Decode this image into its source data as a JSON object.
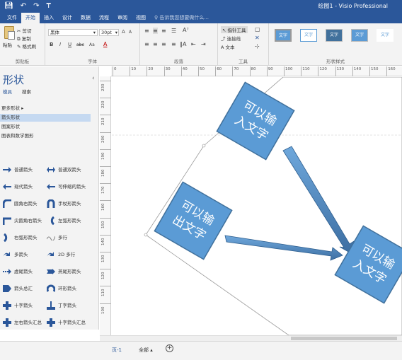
{
  "window": {
    "title": "绘图1 - Visio Professional",
    "qat": {
      "save_icon": "save-icon",
      "undo_icon": "undo-icon",
      "redo_icon": "redo-icon",
      "customize_icon": "customize-icon"
    }
  },
  "tabs": [
    {
      "label": "文件"
    },
    {
      "label": "开始"
    },
    {
      "label": "插入"
    },
    {
      "label": "设计"
    },
    {
      "label": "数据"
    },
    {
      "label": "流程"
    },
    {
      "label": "审阅"
    },
    {
      "label": "视图"
    }
  ],
  "tell_me": "♀ 告诉我您想要做什么...",
  "ribbon": {
    "clipboard": {
      "paste": "粘贴",
      "cut": "剪切",
      "copy": "复制",
      "format_painter": "格式刷",
      "label": "剪贴板"
    },
    "font": {
      "font_name": "黑体",
      "font_size": "30pt",
      "bold": "B",
      "italic": "I",
      "underline": "U",
      "strike": "abc",
      "case": "Aa",
      "font_color": "A",
      "grow": "A",
      "shrink": "A",
      "label": "字体"
    },
    "paragraph": {
      "label": "段落"
    },
    "tools": {
      "pointer": "指针工具",
      "connector": "连接线",
      "text": "A 文本",
      "label": "工具"
    },
    "shape_styles": {
      "label": "形状样式",
      "sample": "文字"
    }
  },
  "panel": {
    "title": "形状",
    "tabs": [
      "模具",
      "搜索"
    ],
    "stencils": [
      {
        "label": "更多形状  ▸"
      },
      {
        "label": "箭头形状"
      },
      {
        "label": "图案形状"
      },
      {
        "label": "图表和数学图形"
      }
    ],
    "shapes": [
      {
        "label": "普通箭头"
      },
      {
        "label": "普通双箭头"
      },
      {
        "label": "现代箭头"
      },
      {
        "label": "可伸缩的箭头"
      },
      {
        "label": "圆角右箭头"
      },
      {
        "label": "手杖形箭头"
      },
      {
        "label": "尖圆角右箭头"
      },
      {
        "label": "左弧形箭头"
      },
      {
        "label": "右弧形箭头"
      },
      {
        "label": "多行"
      },
      {
        "label": "多箭头"
      },
      {
        "label": "2D 多行"
      },
      {
        "label": "虚尾箭头"
      },
      {
        "label": "燕尾形箭头"
      },
      {
        "label": "箭头总汇"
      },
      {
        "label": "环形箭头"
      },
      {
        "label": "十字箭头"
      },
      {
        "label": "丁字箭头"
      },
      {
        "label": "左右箭头汇总"
      },
      {
        "label": "十字箭头汇总"
      }
    ]
  },
  "rulers": {
    "h": [
      "0",
      "10",
      "20",
      "30",
      "40",
      "50",
      "60",
      "70",
      "80",
      "90",
      "100",
      "110",
      "120",
      "130",
      "140",
      "150",
      "160"
    ],
    "v": [
      "230",
      "220",
      "210",
      "200",
      "190",
      "180",
      "170",
      "160",
      "150",
      "140",
      "130",
      "120",
      "110",
      "100"
    ]
  },
  "diagram": {
    "boxes": [
      {
        "line1": "可以输",
        "line2": "入文字"
      },
      {
        "line1": "可以输",
        "line2": "出文字"
      },
      {
        "line1": "可以输",
        "line2": "入文字"
      }
    ],
    "colors": {
      "fill": "#5b9bd5",
      "stroke": "#41719c"
    }
  },
  "pagebar": {
    "page": "页-1",
    "all": "全部 ▴",
    "add": "+"
  }
}
